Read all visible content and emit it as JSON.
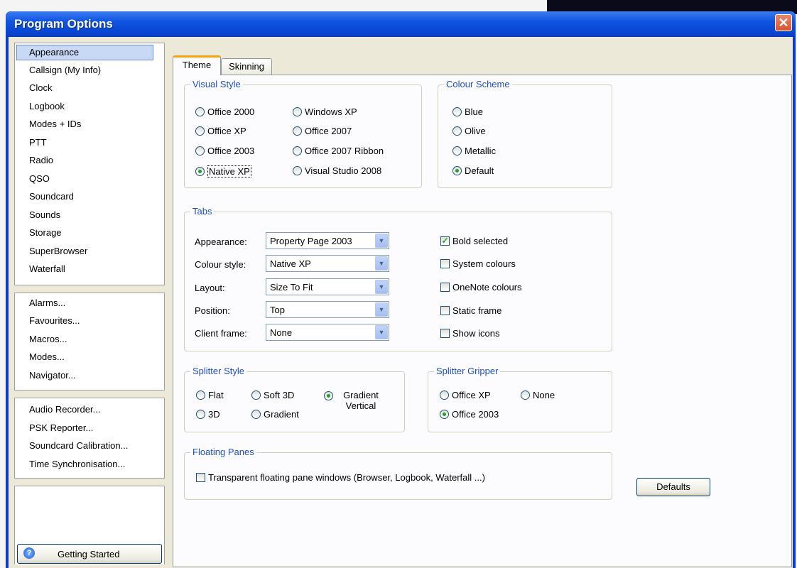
{
  "window": {
    "title": "Program Options",
    "close_glyph": "✕"
  },
  "sidebar": {
    "groups": [
      [
        "Appearance",
        "Callsign (My Info)",
        "Clock",
        "Logbook",
        "Modes + IDs",
        "PTT",
        "Radio",
        "QSO",
        "Soundcard",
        "Sounds",
        "Storage",
        "SuperBrowser",
        "Waterfall"
      ],
      [
        "Alarms...",
        "Favourites...",
        "Macros...",
        "Modes...",
        "Navigator..."
      ],
      [
        "Audio Recorder...",
        "PSK Reporter...",
        "Soundcard Calibration...",
        "Time Synchronisation..."
      ]
    ],
    "selected": "Appearance",
    "getting_started": "Getting Started"
  },
  "tabs": [
    "Theme",
    "Skinning"
  ],
  "active_tab": "Theme",
  "visual_style": {
    "legend": "Visual Style",
    "options": [
      "Office 2000",
      "Office XP",
      "Office 2003",
      "Native XP",
      "Windows XP",
      "Office 2007",
      "Office 2007 Ribbon",
      "Visual Studio 2008"
    ],
    "selected": "Native XP"
  },
  "colour_scheme": {
    "legend": "Colour Scheme",
    "options": [
      "Blue",
      "Olive",
      "Metallic",
      "Default"
    ],
    "selected": "Default"
  },
  "tabs_group": {
    "legend": "Tabs",
    "fields": [
      {
        "label": "Appearance:",
        "value": "Property Page 2003"
      },
      {
        "label": "Colour style:",
        "value": "Native XP"
      },
      {
        "label": "Layout:",
        "value": "Size To Fit"
      },
      {
        "label": "Position:",
        "value": "Top"
      },
      {
        "label": "Client frame:",
        "value": "None"
      }
    ],
    "checks": [
      {
        "label": "Bold selected",
        "checked": true
      },
      {
        "label": "System colours",
        "checked": false
      },
      {
        "label": "OneNote colours",
        "checked": false
      },
      {
        "label": "Static frame",
        "checked": false
      },
      {
        "label": "Show icons",
        "checked": false
      }
    ]
  },
  "splitter_style": {
    "legend": "Splitter Style",
    "options": [
      "Flat",
      "3D",
      "Soft 3D",
      "Gradient",
      "Gradient Vertical"
    ],
    "selected": "Gradient Vertical"
  },
  "splitter_gripper": {
    "legend": "Splitter Gripper",
    "options": [
      "Office XP",
      "Office 2003",
      "None"
    ],
    "selected": "Office 2003"
  },
  "floating_panes": {
    "legend": "Floating Panes",
    "transparent_label": "Transparent floating pane windows (Browser, Logbook, Waterfall ...)",
    "transparent_checked": false
  },
  "defaults_button": "Defaults",
  "colors": {
    "title_blue": "#0846d2",
    "accent_green": "#21a121",
    "legend_blue": "#1f4fc0",
    "face": "#ece9d8"
  },
  "icons": {
    "close": "close-icon",
    "getting_started": "help-icon",
    "check": "checkmark-icon",
    "dropdown": "chevron-down-icon"
  }
}
